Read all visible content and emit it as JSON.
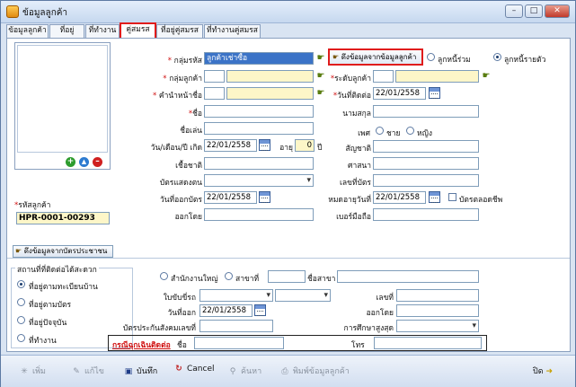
{
  "window": {
    "title": "ข้อมูลลูกค้า"
  },
  "tabs": [
    "ข้อมูลลูกค้า",
    "ที่อยู่",
    "ที่ทำงาน",
    "คู่สมรส",
    "ที่อยู่คู่สมรส",
    "ที่ทำงานคู่สมรส"
  ],
  "photo_panel": {
    "icons": [
      "add-icon",
      "upload-icon",
      "delete-icon"
    ]
  },
  "customer": {
    "code_label": "รหัสลูกค้า",
    "code_value": "HPR-0001-00293",
    "fetch_card_button": "ดึงข้อมูลจากบัตรประชาชน"
  },
  "spouse_form": {
    "group_code_label": "กลุ่มรหัส",
    "group_code_value": "ลูกค้าเช่าซื้อ",
    "fetch_from_customer_button": "ดึงข้อมูลจากข้อมูลลูกค้า",
    "radio_joint_debtor": "ลูกหนี้ร่วม",
    "radio_single_debtor": "ลูกหนี้รายตัว",
    "customer_group_label": "กลุ่มลูกค้า",
    "level_label": "ระดับลูกค้า",
    "prefix_label": "คำนำหน้าชื่อ",
    "contact_date_label": "วันที่ติดต่อ",
    "contact_date_value": "22/01/2558",
    "first_name_label": "ชื่อ",
    "last_name_label": "นามสกุล",
    "nickname_label": "ชื่อเล่น",
    "gender_label": "เพศ",
    "gender_male": "ชาย",
    "gender_female": "หญิง",
    "birth_date_label": "วัน/เดือน/ปี เกิด",
    "birth_date_value": "22/01/2558",
    "age_label": "อายุ",
    "age_value": "0",
    "age_unit": "ปี",
    "nationality_label": "สัญชาติ",
    "ethnicity_label": "เชื้อชาติ",
    "religion_label": "ศาสนา",
    "id_card_type_label": "บัตรแสดงตน",
    "id_card_number_label": "เลขที่บัตร",
    "issue_date_label": "วันที่ออกบัตร",
    "issue_date_value": "22/01/2558",
    "expiry_date_label": "หมดอายุวันที่",
    "expiry_date_value": "22/01/2558",
    "lifetime_card_label": "บัตรตลอดชีพ",
    "issued_by_label": "ออกโดย",
    "mobile_label": "เบอร์มือถือ"
  },
  "contact_place": {
    "title": "สถานที่ที่ติดต่อได้สะดวก",
    "options": [
      "ที่อยู่ตามทะเบียนบ้าน",
      "ที่อยู่ตามบัตร",
      "ที่อยู่ปัจจุบัน",
      "ที่ทำงาน"
    ]
  },
  "business": {
    "head_office_label": "สำนักงานใหญ่",
    "branch_label": "สาขาที่",
    "branch_name_label": "ชื่อสาขา",
    "license_label": "ใบขับขี่รถ",
    "number_label": "เลขที่",
    "issue_date_label": "วันที่ออก",
    "issue_date_value": "22/01/2558",
    "issued_by_label": "ออกโดย",
    "social_security_label": "บัตรประกันสังคมเลขที่",
    "education_label": "การศึกษาสูงสุด",
    "emergency_contact_label": "กรณีฉุกเฉินติดต่อ",
    "emergency_name_label": "ชื่อ",
    "phone_label": "โทร"
  },
  "toolbar": {
    "add": "เพิ่ม",
    "edit": "แก้ไข",
    "save": "บันทึก",
    "cancel": "Cancel",
    "search": "ค้นหา",
    "print": "พิมพ์ข้อมูลลูกค้า",
    "close": "ปิด"
  },
  "colors": {
    "required": "#d01010",
    "highlight": "#e01c1c",
    "field_yellow": "#fdf6c8",
    "selection": "#3b73c7"
  }
}
